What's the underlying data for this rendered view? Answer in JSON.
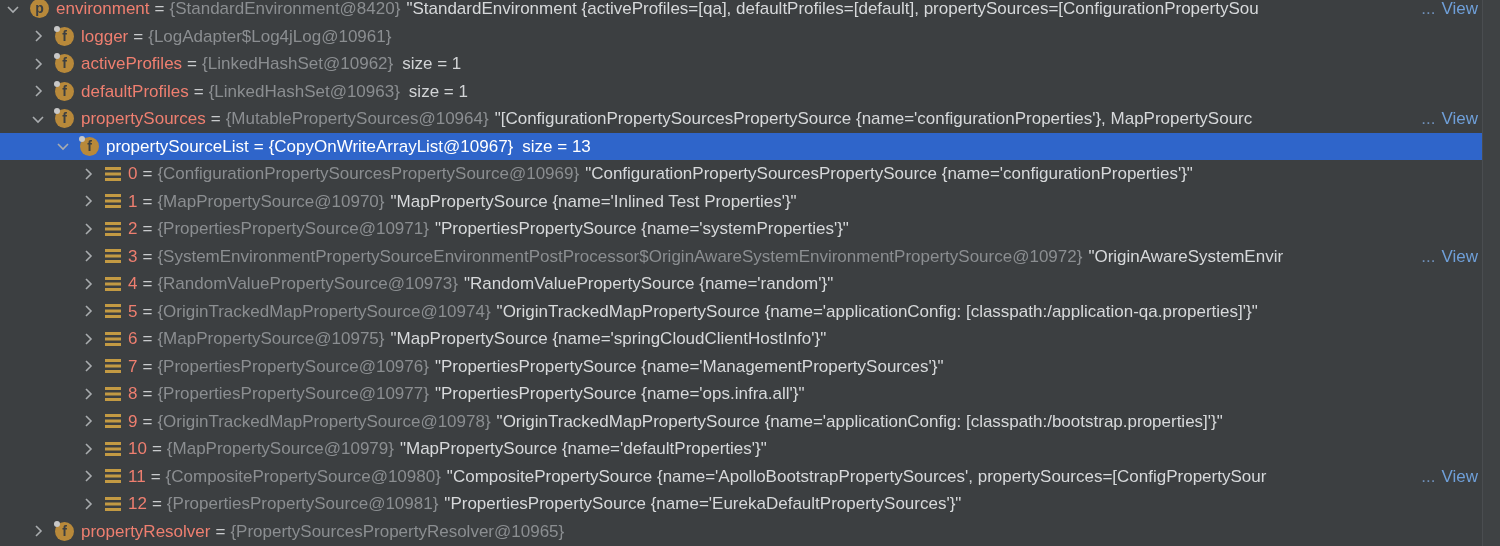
{
  "tree": [
    {
      "kind": "object",
      "icon_letter": "p",
      "name": "environment",
      "op": "=",
      "type": "{StandardEnvironment@8420}",
      "value": "\"StandardEnvironment {activeProfiles=[qa], defaultProfiles=[default], propertySources=[ConfigurationPropertySou",
      "ellipsis": "...",
      "link": "View",
      "expanded": true,
      "selected": false,
      "children": [
        {
          "kind": "field",
          "icon_letter": "f",
          "name": "logger",
          "op": "=",
          "type": "{LogAdapter$Log4jLog@10961}",
          "expanded": false,
          "selected": false
        },
        {
          "kind": "field",
          "icon_letter": "f",
          "name": "activeProfiles",
          "op": "=",
          "type": "{LinkedHashSet@10962}",
          "size": "size = 1",
          "expanded": false,
          "selected": false
        },
        {
          "kind": "field",
          "icon_letter": "f",
          "name": "defaultProfiles",
          "op": "=",
          "type": "{LinkedHashSet@10963}",
          "size": "size = 1",
          "expanded": false,
          "selected": false
        },
        {
          "kind": "field",
          "icon_letter": "f",
          "name": "propertySources",
          "op": "=",
          "type": "{MutablePropertySources@10964}",
          "value": "\"[ConfigurationPropertySourcesPropertySource {name='configurationProperties'}, MapPropertySourc",
          "ellipsis": "...",
          "link": "View",
          "expanded": true,
          "selected": false,
          "children": [
            {
              "kind": "field",
              "icon_letter": "f",
              "name": "propertySourceList",
              "op": "=",
              "type": "{CopyOnWriteArrayList@10967}",
              "size": "size = 13",
              "expanded": true,
              "selected": true,
              "children": [
                {
                  "kind": "element",
                  "name": "0",
                  "op": "=",
                  "type": "{ConfigurationPropertySourcesPropertySource@10969}",
                  "value": "\"ConfigurationPropertySourcesPropertySource {name='configurationProperties'}\"",
                  "expanded": false,
                  "selected": false
                },
                {
                  "kind": "element",
                  "name": "1",
                  "op": "=",
                  "type": "{MapPropertySource@10970}",
                  "value": "\"MapPropertySource {name='Inlined Test Properties'}\"",
                  "expanded": false,
                  "selected": false
                },
                {
                  "kind": "element",
                  "name": "2",
                  "op": "=",
                  "type": "{PropertiesPropertySource@10971}",
                  "value": "\"PropertiesPropertySource {name='systemProperties'}\"",
                  "expanded": false,
                  "selected": false
                },
                {
                  "kind": "element",
                  "name": "3",
                  "op": "=",
                  "type": "{SystemEnvironmentPropertySourceEnvironmentPostProcessor$OriginAwareSystemEnvironmentPropertySource@10972}",
                  "value": "\"OriginAwareSystemEnvir",
                  "ellipsis": "...",
                  "link": "View",
                  "expanded": false,
                  "selected": false
                },
                {
                  "kind": "element",
                  "name": "4",
                  "op": "=",
                  "type": "{RandomValuePropertySource@10973}",
                  "value": "\"RandomValuePropertySource {name='random'}\"",
                  "expanded": false,
                  "selected": false
                },
                {
                  "kind": "element",
                  "name": "5",
                  "op": "=",
                  "type": "{OriginTrackedMapPropertySource@10974}",
                  "value": "\"OriginTrackedMapPropertySource {name='applicationConfig: [classpath:/application-qa.properties]'}\"",
                  "expanded": false,
                  "selected": false
                },
                {
                  "kind": "element",
                  "name": "6",
                  "op": "=",
                  "type": "{MapPropertySource@10975}",
                  "value": "\"MapPropertySource {name='springCloudClientHostInfo'}\"",
                  "expanded": false,
                  "selected": false
                },
                {
                  "kind": "element",
                  "name": "7",
                  "op": "=",
                  "type": "{PropertiesPropertySource@10976}",
                  "value": "\"PropertiesPropertySource {name='ManagementPropertySources'}\"",
                  "expanded": false,
                  "selected": false
                },
                {
                  "kind": "element",
                  "name": "8",
                  "op": "=",
                  "type": "{PropertiesPropertySource@10977}",
                  "value": "\"PropertiesPropertySource {name='ops.infra.all'}\"",
                  "expanded": false,
                  "selected": false
                },
                {
                  "kind": "element",
                  "name": "9",
                  "op": "=",
                  "type": "{OriginTrackedMapPropertySource@10978}",
                  "value": "\"OriginTrackedMapPropertySource {name='applicationConfig: [classpath:/bootstrap.properties]'}\"",
                  "expanded": false,
                  "selected": false
                },
                {
                  "kind": "element",
                  "name": "10",
                  "op": "=",
                  "type": "{MapPropertySource@10979}",
                  "value": "\"MapPropertySource {name='defaultProperties'}\"",
                  "expanded": false,
                  "selected": false
                },
                {
                  "kind": "element",
                  "name": "11",
                  "op": "=",
                  "type": "{CompositePropertySource@10980}",
                  "value": "\"CompositePropertySource {name='ApolloBootstrapPropertySources', propertySources=[ConfigPropertySour",
                  "ellipsis": "...",
                  "link": "View",
                  "expanded": false,
                  "selected": false
                },
                {
                  "kind": "element",
                  "name": "12",
                  "op": "=",
                  "type": "{PropertiesPropertySource@10981}",
                  "value": "\"PropertiesPropertySource {name='EurekaDefaultPropertySources'}\"",
                  "expanded": false,
                  "selected": false
                }
              ]
            }
          ]
        },
        {
          "kind": "field",
          "icon_letter": "f",
          "name": "propertyResolver",
          "op": "=",
          "type": "{PropertySourcesPropertyResolver@10965}",
          "expanded": false,
          "selected": false
        }
      ]
    }
  ]
}
